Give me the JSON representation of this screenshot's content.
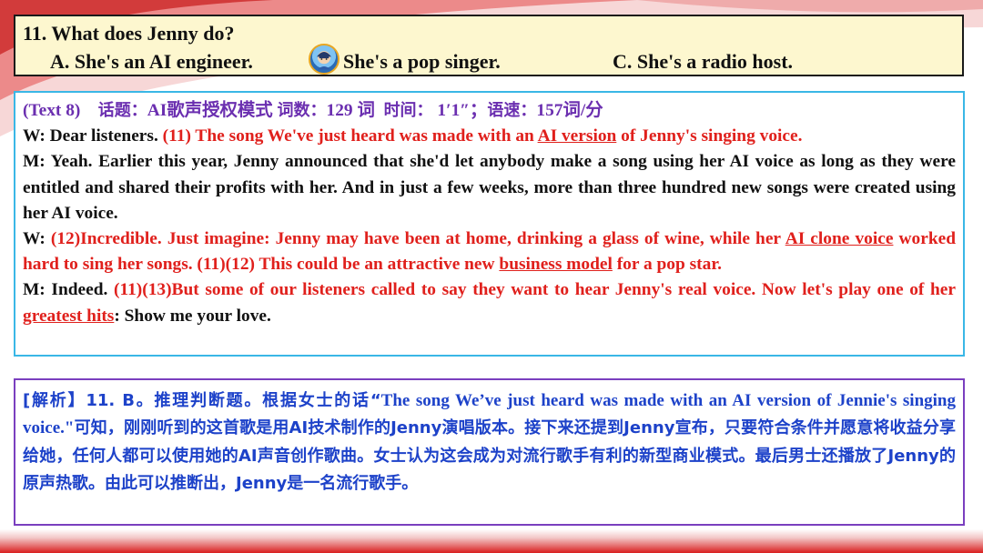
{
  "question": {
    "stem": "11. What does Jenny do?",
    "option_a": "A. She's an AI engineer.",
    "option_b": "She's a pop singer.",
    "option_c": "C. She's a radio host."
  },
  "transcript": {
    "header": {
      "label": "(Text 8)",
      "topic_label": "话题：",
      "topic_value": "AI歌声授权模式",
      "wordcount_label": "词数：",
      "wordcount_value": "129 词",
      "time_label": "时间：",
      "time_value": "1′1″；",
      "speed_label": "语速：",
      "speed_value": "157词/分"
    },
    "p1": {
      "speaker": "W: Dear listeners. ",
      "red1": "(11) The song We've just heard was made with an ",
      "underline": "AI version",
      "red2": " of Jenny's singing voice."
    },
    "p2": {
      "text": "M: Yeah. Earlier this year, Jenny announced that she'd let anybody make a song using her AI voice as long as they were entitled and shared their profits with her. And in just a few weeks, more than three hundred new songs were created using her AI voice."
    },
    "p3": {
      "speaker": "W: ",
      "red1": "(12)Incredible. Just imagine: Jenny may have been at home, drinking a glass of wine, while her ",
      "underline1": "AI clone voice",
      "red2": " worked hard to sing her songs. (11)(12) This could be an attractive new ",
      "underline2": "business model",
      "red3": " for a pop star."
    },
    "p4": {
      "speaker": "M: Indeed. ",
      "red1": "(11)(13)But some of our listeners called to say they want to hear Jenny's real voice. Now let's play one of her ",
      "underline": "greatest hits",
      "red2": ": Show me your love."
    }
  },
  "analysis": {
    "text1": "[解析】11. B。推理判断题。根据女士的话“",
    "text2": "The song We’ve just heard was made with an AI version of Jennie's singing voice.\"",
    "text3": "可知，刚刚听到的这首歌是用AI技术制作的Jenny演唱版本。接下来还提到Jenny宣布，只要符合条件并愿意将收益分享给她，任何人都可以使用她的AI声音创作歌曲。女士认为这会成为对流行歌手有利的新型商业模式。最后男士还播放了Jenny的原声热歌。由此可以推断出，Jenny是一名流行歌手。"
  },
  "colors": {
    "question_bg": "#fdf7cf",
    "text_border": "#3ab7e6",
    "analysis_border": "#7a3fbf",
    "header_purple": "#6b2fb0",
    "highlight_red": "#e0201c",
    "analysis_blue": "#1d42c9"
  }
}
